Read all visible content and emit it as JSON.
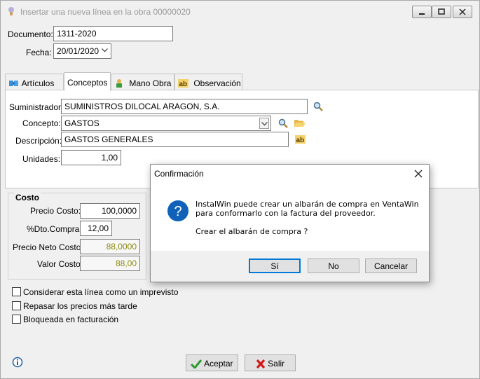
{
  "window": {
    "title": "Insertar una nueva línea en la obra 00000020"
  },
  "header": {
    "documento_label": "Documento:",
    "documento_value": "1311-2020",
    "fecha_label": "Fecha:",
    "fecha_value": "20/01/2020"
  },
  "tabs": [
    {
      "label": "Artículos",
      "icon": "puzzle-icon"
    },
    {
      "label": "Conceptos",
      "active": true
    },
    {
      "label": "Mano Obra",
      "icon": "worker-icon"
    },
    {
      "label": "Observación",
      "icon": "ab-icon"
    }
  ],
  "conceptos": {
    "suministrador_label": "Suministrador:",
    "suministrador_value": "SUMINISTROS DILOCAL ARAGON, S.A.",
    "concepto_label": "Concepto:",
    "concepto_value": "GASTOS",
    "descripcion_label": "Descripción:",
    "descripcion_value": "GASTOS GENERALES",
    "unidades_label": "Unidades:",
    "unidades_value": "1,00"
  },
  "costo": {
    "title": "Costo",
    "precio_costo_label": "Precio Costo:",
    "precio_costo_value": "100,0000",
    "dto_compra_label": "%Dto.Compra:",
    "dto_compra_value": "12,00",
    "precio_neto_label": "Precio Neto Costo:",
    "precio_neto_value": "88,0000",
    "valor_costo_label": "Valor Costo",
    "valor_costo_value": "88,00"
  },
  "options": [
    {
      "label": "Considerar esta línea como un imprevisto",
      "checked": false
    },
    {
      "label": "Repasar los precios más tarde",
      "checked": false
    },
    {
      "label": "Bloqueada en facturación",
      "checked": false
    }
  ],
  "footer": {
    "accept_label": "Aceptar",
    "exit_label": "Salir"
  },
  "dialog": {
    "title": "Confirmación",
    "message_line1": "InstalWin puede crear un albarán de compra en VentaWin",
    "message_line2": "para conformarlo con la factura del proveedor.",
    "question": "Crear el albarán de compra ?",
    "yes_label": "Sí",
    "no_label": "No",
    "cancel_label": "Cancelar"
  },
  "colors": {
    "readonly_text": "#8a8a10",
    "question_icon": "#0f62b8",
    "default_button_border": "#0078d7"
  }
}
